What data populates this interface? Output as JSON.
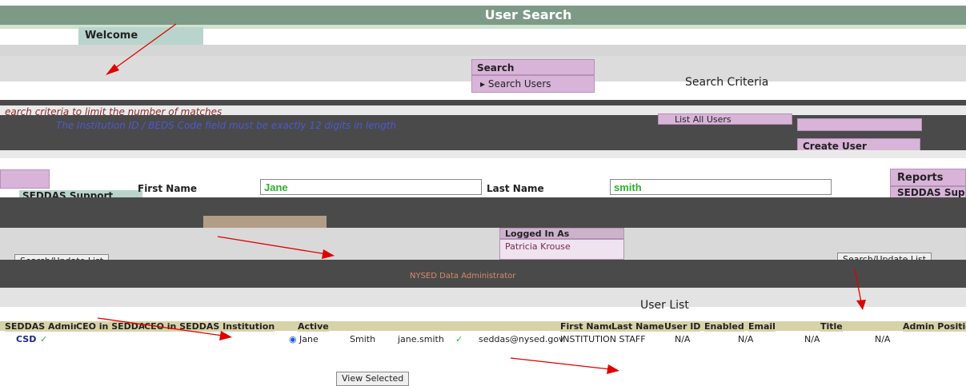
{
  "header": {
    "title": "User Search"
  },
  "sidebar": {
    "welcome_label": "Welcome"
  },
  "search_menu": {
    "title": "Search",
    "item": "Search Users"
  },
  "main": {
    "criteria_title": "Search Criteria",
    "hint_lines": [
      "earch criteria to limit the number of matches",
      "The Institution ID / BEDS Code field must be exactly 12 digits in length"
    ],
    "list_all_users": "List All Users",
    "create_user": "Create User",
    "first_name_label": "First Name",
    "first_name_value": "Jane",
    "last_name_label": "Last Name",
    "last_name_value": "smith",
    "logged_in_as": "Logged In As",
    "logged_in_user": "Patricia Krouse",
    "role_text": "NYSED Data Administrator",
    "search_update_list": "Search/Update List",
    "user_list_title": "User List",
    "view_selected": "View Selected"
  },
  "right_menu": {
    "reports": "Reports",
    "support": "SEDDAS Support"
  },
  "left_menu": {
    "support": "SEDDAS Support"
  },
  "table": {
    "headers": [
      "SEDDAS Admin",
      "CEO in SEDDAS",
      "CEO in SEDDAS Institution",
      "Active",
      "First Name",
      "Last Name",
      "User ID",
      "Enabled",
      "Email",
      "Title",
      "Admin Position"
    ],
    "row": {
      "org": "CSD",
      "first_name": "Jane",
      "last_name": "Smith",
      "user_id": "jane.smith",
      "email": "seddas@nysed.gov",
      "title": "INSTITUTION STAFF",
      "na1": "N/A",
      "na2": "N/A",
      "na3": "N/A",
      "na4": "N/A"
    }
  },
  "colors": {
    "header_bg": "#7d9a86",
    "menu_bg": "#d8b4d8",
    "input_text": "#2fae2f",
    "arrow": "#e00000"
  }
}
